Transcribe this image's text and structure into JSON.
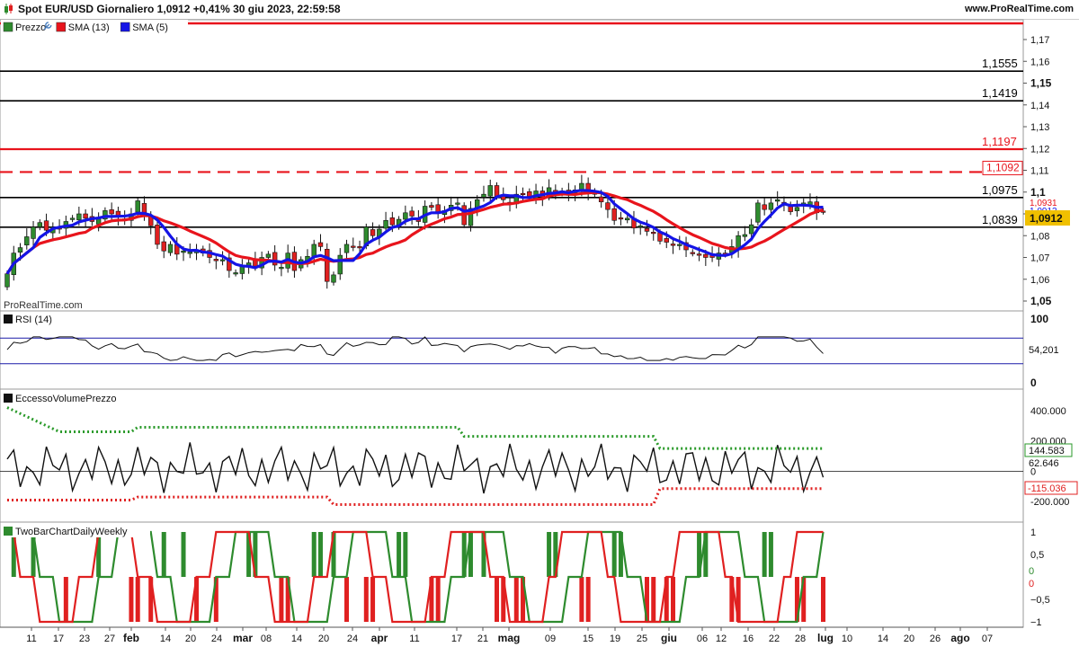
{
  "header": {
    "title": "Spot EUR/USD Giornaliero 1,0912 +0,41% 30 giu 2023, 22:59:58",
    "brand": "www.ProRealTime.com",
    "watermark": "ProRealTime.com"
  },
  "colors": {
    "up_candle": "#2e8b2e",
    "down_candle": "#e02020",
    "sma13": "#e8141c",
    "sma5": "#1414e6",
    "support_line": "#000000",
    "resistance_red": "#e8141c",
    "rsi_band": "#1a1aa8",
    "upper_band_dotted": "#2a9a2a",
    "lower_band_dotted": "#e02020",
    "price_box": "#f0c000"
  },
  "chart_data": [
    {
      "type": "candlestick",
      "panel": "price",
      "legend": [
        "Prezzo",
        "SMA (13)",
        "SMA (5)"
      ],
      "y_ticks": [
        "1,17",
        "1,16",
        "1,15",
        "1,14",
        "1,13",
        "1,12",
        "1,11",
        "1,1",
        "1,09",
        "1,08",
        "1,07",
        "1,06",
        "1,05"
      ],
      "ylim": [
        1.05,
        1.17
      ],
      "horizontal_levels": [
        {
          "value": 1.1555,
          "label": "1,1555",
          "color": "#000000",
          "style": "solid"
        },
        {
          "value": 1.1419,
          "label": "1,1419",
          "color": "#000000",
          "style": "solid"
        },
        {
          "value": 1.1197,
          "label": "1,1197",
          "color": "#e8141c",
          "style": "solid"
        },
        {
          "value": 1.1092,
          "label": "1,1092",
          "color": "#e8141c",
          "style": "dashed"
        },
        {
          "value": 1.0975,
          "label": "1,0975",
          "color": "#000000",
          "style": "solid"
        },
        {
          "value": 1.0839,
          "label": "1,0839",
          "color": "#000000",
          "style": "solid"
        }
      ],
      "right_labels": [
        "1,0931",
        "1,0913"
      ],
      "last_price": "1,0912",
      "close": [
        1.0625,
        1.072,
        1.0745,
        1.0795,
        1.084,
        1.086,
        1.0825,
        1.084,
        1.083,
        1.0865,
        1.088,
        1.09,
        1.088,
        1.0865,
        1.088,
        1.0915,
        1.09,
        1.0885,
        1.087,
        1.09,
        1.096,
        1.0895,
        1.0845,
        1.076,
        1.073,
        1.076,
        1.0715,
        1.073,
        1.0725,
        1.0735,
        1.072,
        1.07,
        1.0685,
        1.069,
        1.064,
        1.063,
        1.066,
        1.0675,
        1.066,
        1.07,
        1.0715,
        1.0665,
        1.0655,
        1.072,
        1.064,
        1.069,
        1.0705,
        1.076,
        1.075,
        1.059,
        1.062,
        1.071,
        1.076,
        1.075,
        1.0745,
        1.084,
        1.08,
        1.083,
        1.087,
        1.085,
        1.0875,
        1.0905,
        1.089,
        1.0865,
        1.0935,
        1.093,
        1.0905,
        1.0915,
        1.094,
        1.095,
        1.085,
        1.0925,
        1.0965,
        1.099,
        1.103,
        1.098,
        1.0965,
        1.095,
        1.099,
        1.099,
        1.098,
        1.1005,
        1.0975,
        1.102,
        1.1,
        1.1005,
        1.0985,
        1.101,
        1.104,
        1.0995,
        1.099,
        1.0955,
        1.092,
        1.087,
        1.088,
        1.088,
        1.0835,
        1.0845,
        1.082,
        1.081,
        1.0775,
        1.077,
        1.0755,
        1.076,
        1.0735,
        1.072,
        1.071,
        1.07,
        1.07,
        1.072,
        1.0715,
        1.075,
        1.08,
        1.0805,
        1.085,
        1.095,
        1.092,
        1.095,
        1.0965,
        1.0945,
        1.091,
        1.093,
        1.095,
        1.0955,
        1.0905,
        1.0912
      ]
    },
    {
      "type": "line",
      "panel": "rsi",
      "legend": "RSI (14)",
      "y_ticks": [
        "100",
        "0"
      ],
      "ylim": [
        0,
        100
      ],
      "bands": [
        70,
        30
      ],
      "last_value": "54,201"
    },
    {
      "type": "line",
      "panel": "volume_excess",
      "legend": "EccessoVolumePrezzo",
      "y_ticks": [
        "400.000",
        "200.000",
        "0",
        "-200.000"
      ],
      "ylim": [
        -300000,
        500000
      ],
      "last_values": [
        "144.583",
        "62.646",
        "-115.036"
      ]
    },
    {
      "type": "step",
      "panel": "two_bar",
      "legend": "TwoBarChartDailyWeekly",
      "y_ticks": [
        "1",
        "0,5",
        "0",
        "-0,5",
        "-1"
      ],
      "ylim": [
        -1,
        1
      ],
      "last_values": [
        "0",
        "0"
      ]
    }
  ],
  "x_axis": {
    "labels": [
      {
        "text": "11",
        "bold": false
      },
      {
        "text": "17",
        "bold": false
      },
      {
        "text": "23",
        "bold": false
      },
      {
        "text": "27",
        "bold": false
      },
      {
        "text": "feb",
        "bold": true
      },
      {
        "text": "14",
        "bold": false
      },
      {
        "text": "20",
        "bold": false
      },
      {
        "text": "24",
        "bold": false
      },
      {
        "text": "mar",
        "bold": true
      },
      {
        "text": "08",
        "bold": false
      },
      {
        "text": "14",
        "bold": false
      },
      {
        "text": "20",
        "bold": false
      },
      {
        "text": "24",
        "bold": false
      },
      {
        "text": "apr",
        "bold": true
      },
      {
        "text": "11",
        "bold": false
      },
      {
        "text": "17",
        "bold": false
      },
      {
        "text": "21",
        "bold": false
      },
      {
        "text": "mag",
        "bold": true
      },
      {
        "text": "09",
        "bold": false
      },
      {
        "text": "15",
        "bold": false
      },
      {
        "text": "19",
        "bold": false
      },
      {
        "text": "25",
        "bold": false
      },
      {
        "text": "giu",
        "bold": true
      },
      {
        "text": "06",
        "bold": false
      },
      {
        "text": "12",
        "bold": false
      },
      {
        "text": "16",
        "bold": false
      },
      {
        "text": "22",
        "bold": false
      },
      {
        "text": "28",
        "bold": false
      },
      {
        "text": "lug",
        "bold": true
      },
      {
        "text": "10",
        "bold": false
      },
      {
        "text": "14",
        "bold": false
      },
      {
        "text": "20",
        "bold": false
      },
      {
        "text": "26",
        "bold": false
      },
      {
        "text": "ago",
        "bold": true
      },
      {
        "text": "07",
        "bold": false
      }
    ]
  }
}
